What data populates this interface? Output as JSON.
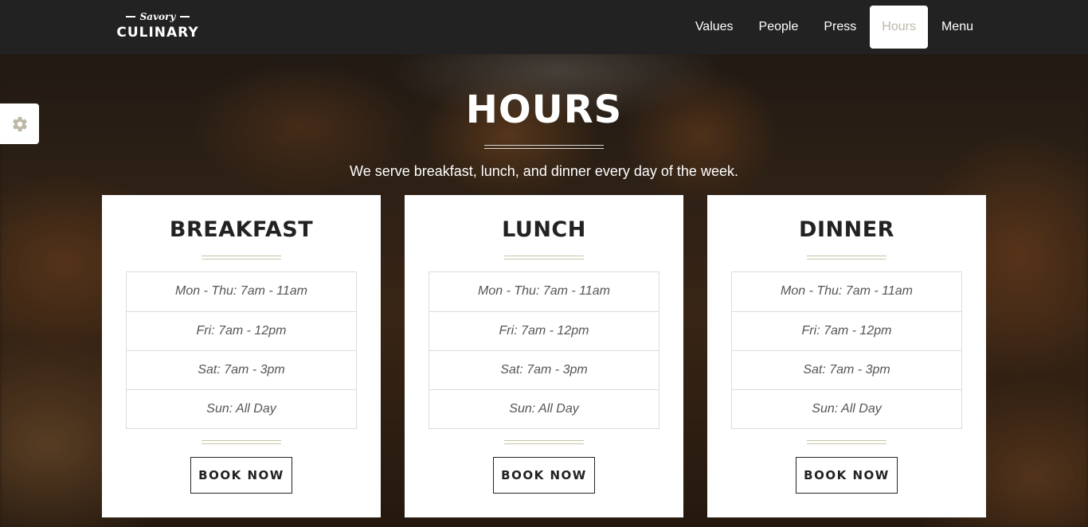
{
  "brand": {
    "script": "Savory",
    "name": "CULINARY"
  },
  "nav": {
    "items": [
      {
        "label": "Values",
        "active": false
      },
      {
        "label": "People",
        "active": false
      },
      {
        "label": "Press",
        "active": false
      },
      {
        "label": "Hours",
        "active": true
      },
      {
        "label": "Menu",
        "active": false
      }
    ]
  },
  "settings": {
    "icon": "gear-icon",
    "color": "#bdb8a8"
  },
  "hero": {
    "title": "HOURS",
    "subtitle": "We serve breakfast, lunch, and dinner every day of the week."
  },
  "cards": [
    {
      "title": "BREAKFAST",
      "hours": [
        "Mon - Thu: 7am - 11am",
        "Fri: 7am - 12pm",
        "Sat: 7am - 3pm",
        "Sun: All Day"
      ],
      "button": "BOOK NOW"
    },
    {
      "title": "LUNCH",
      "hours": [
        "Mon - Thu: 7am - 11am",
        "Fri: 7am - 12pm",
        "Sat: 7am - 3pm",
        "Sun: All Day"
      ],
      "button": "BOOK NOW"
    },
    {
      "title": "DINNER",
      "hours": [
        "Mon - Thu: 7am - 11am",
        "Fri: 7am - 12pm",
        "Sat: 7am - 3pm",
        "Sun: All Day"
      ],
      "button": "BOOK NOW"
    }
  ],
  "colors": {
    "navbar": "#222222",
    "accent": "#bdb8a8",
    "rule": "#c8c6a8"
  }
}
